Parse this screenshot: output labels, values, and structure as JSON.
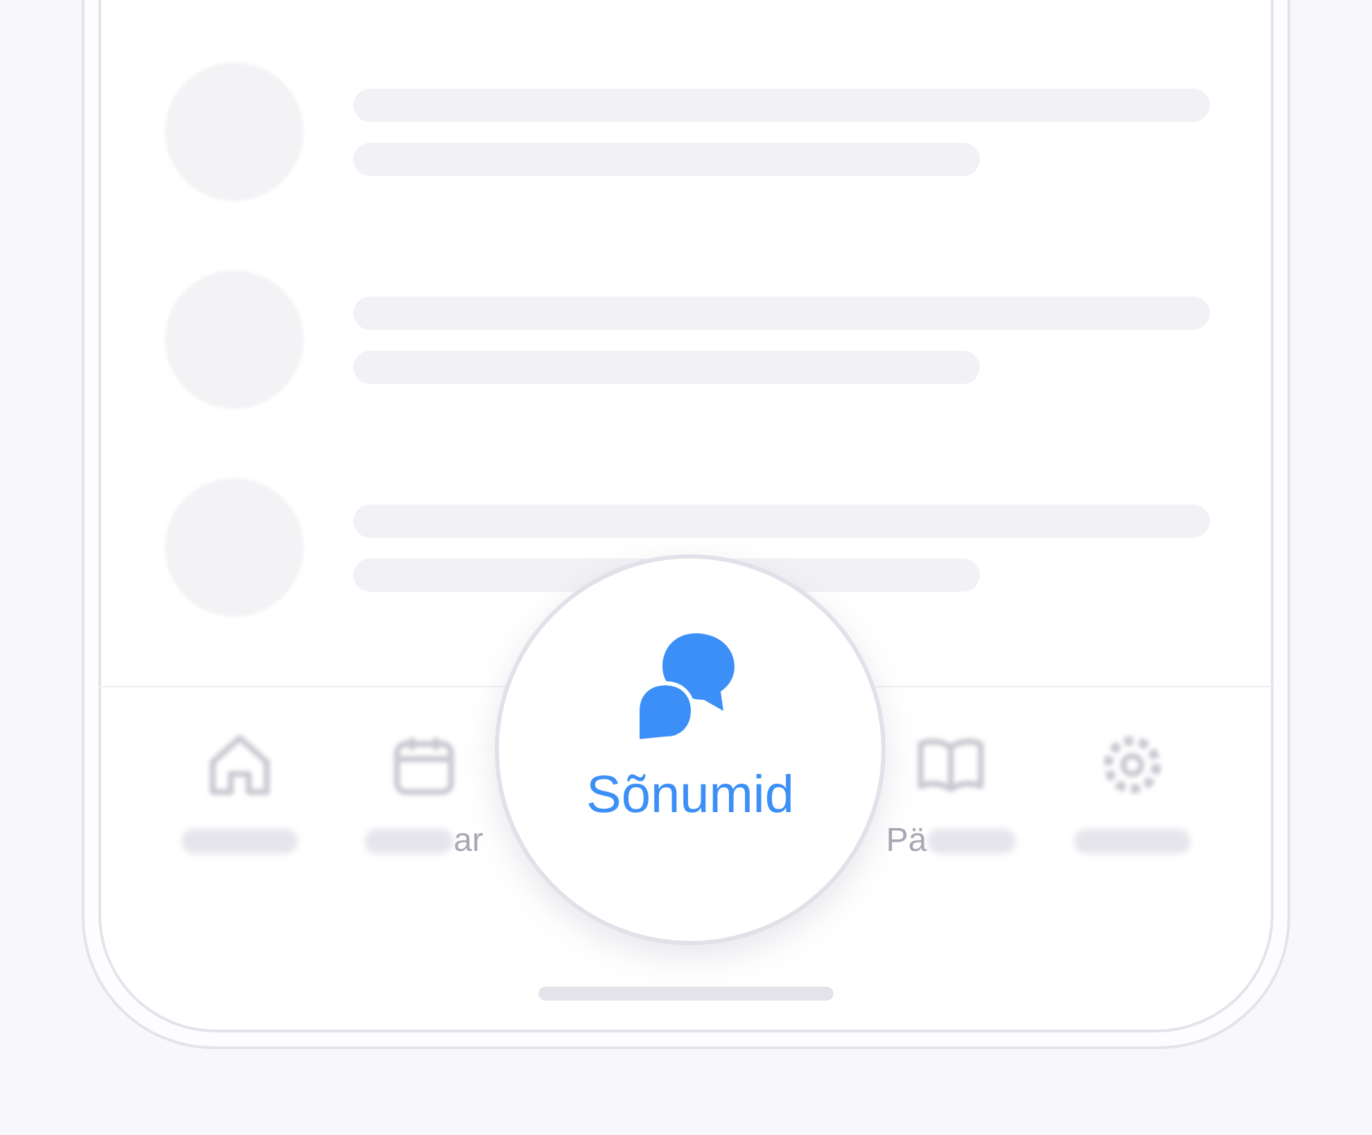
{
  "list": {
    "rows": [
      {
        "kind": "placeholder"
      },
      {
        "kind": "placeholder"
      },
      {
        "kind": "placeholder"
      }
    ]
  },
  "tab_bar": {
    "tabs": [
      {
        "kind": "home",
        "selected": false
      },
      {
        "kind": "calendar",
        "selected": false,
        "label": "ar"
      },
      {
        "kind": "chat",
        "selected": true,
        "label": "Sõnumid"
      },
      {
        "kind": "book",
        "selected": false,
        "label": "Pä"
      },
      {
        "kind": "gear",
        "selected": false
      }
    ]
  }
}
